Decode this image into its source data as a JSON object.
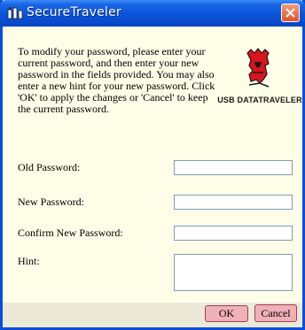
{
  "window": {
    "title": "SecureTraveler"
  },
  "instructions": "To modify your password, please enter your current password, and then enter your new password in the fields provided. You may also enter a new hint for your new password. Click 'OK' to apply the changes or 'Cancel' to keep the current password.",
  "logo": {
    "text": "USB DATATRAVELER"
  },
  "form": {
    "old_password_label": "Old Password:",
    "new_password_label": "New Password:",
    "confirm_password_label": "Confirm New Password:",
    "hint_label": "Hint:",
    "old_password_value": "",
    "new_password_value": "",
    "confirm_password_value": "",
    "hint_value": ""
  },
  "buttons": {
    "ok": "OK",
    "cancel": "Cancel"
  },
  "colors": {
    "titlebar": "#0a53d8",
    "content_bg": "#fdfde8",
    "button_bg": "#f0b0b8",
    "brand_red": "#d8141c"
  }
}
